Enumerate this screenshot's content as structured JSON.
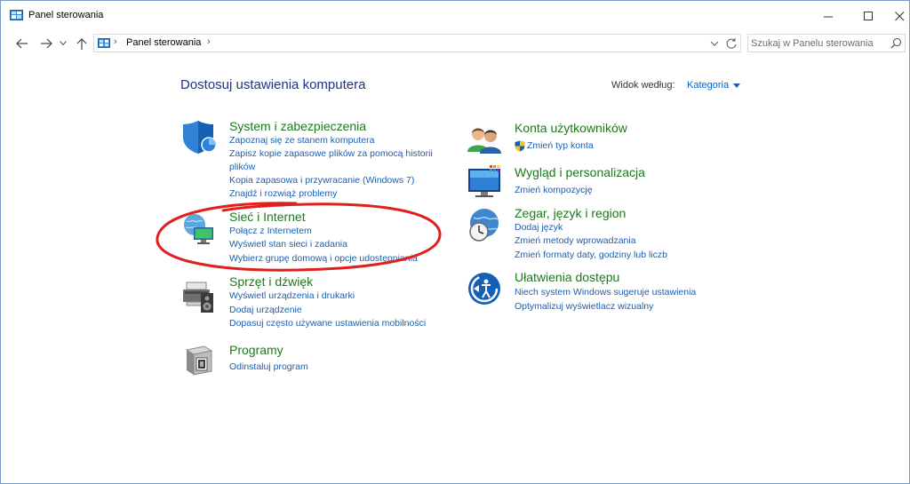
{
  "window": {
    "title": "Panel sterowania"
  },
  "nav": {
    "breadcrumb": "Panel sterowania",
    "search_placeholder": "Szukaj w Panelu sterowania"
  },
  "content": {
    "heading": "Dostosuj ustawienia komputera",
    "viewby_label": "Widok według:",
    "viewby_value": "Kategoria"
  },
  "categories": {
    "system": {
      "title": "System i zabezpieczenia",
      "icon": "security-shield-icon",
      "links": [
        "Zapoznaj się ze stanem komputera",
        "Zapisz kopie zapasowe plików za pomocą historii",
        "plików",
        "Kopia zapasowa i przywracanie (Windows 7)",
        "Znajdź i rozwiąż problemy"
      ]
    },
    "network": {
      "title": "Sieć i Internet",
      "icon": "network-globe-icon",
      "links": [
        "Połącz z Internetem",
        "Wyświetl stan sieci i zadania",
        "Wybierz grupę domową i opcje udostępniania"
      ]
    },
    "hardware": {
      "title": "Sprzęt i dźwięk",
      "icon": "printer-speaker-icon",
      "links": [
        "Wyświetl urządzenia i drukarki",
        "Dodaj urządzenie",
        "Dopasuj często używane ustawienia mobilności"
      ]
    },
    "programs": {
      "title": "Programy",
      "icon": "programs-box-icon",
      "links": [
        "Odinstaluj program"
      ]
    },
    "accounts": {
      "title": "Konta użytkowników",
      "icon": "users-icon",
      "links": [
        "Zmień typ konta"
      ]
    },
    "appearance": {
      "title": "Wygląd i personalizacja",
      "icon": "monitor-colors-icon",
      "links": [
        "Zmień kompozycję"
      ]
    },
    "clock": {
      "title": "Zegar, język i region",
      "icon": "clock-globe-icon",
      "links": [
        "Dodaj język",
        "Zmień metody wprowadzania",
        "Zmień formaty daty, godziny lub liczb"
      ]
    },
    "ease": {
      "title": "Ułatwienia dostępu",
      "icon": "ease-of-access-icon",
      "links": [
        "Niech system Windows sugeruje ustawienia",
        "Optymalizuj wyświetlacz wizualny"
      ]
    }
  },
  "colors": {
    "heading": "#1e3287",
    "category_title": "#1a7a1a",
    "link": "#1a5fb4",
    "annotation": "#e0201c"
  }
}
